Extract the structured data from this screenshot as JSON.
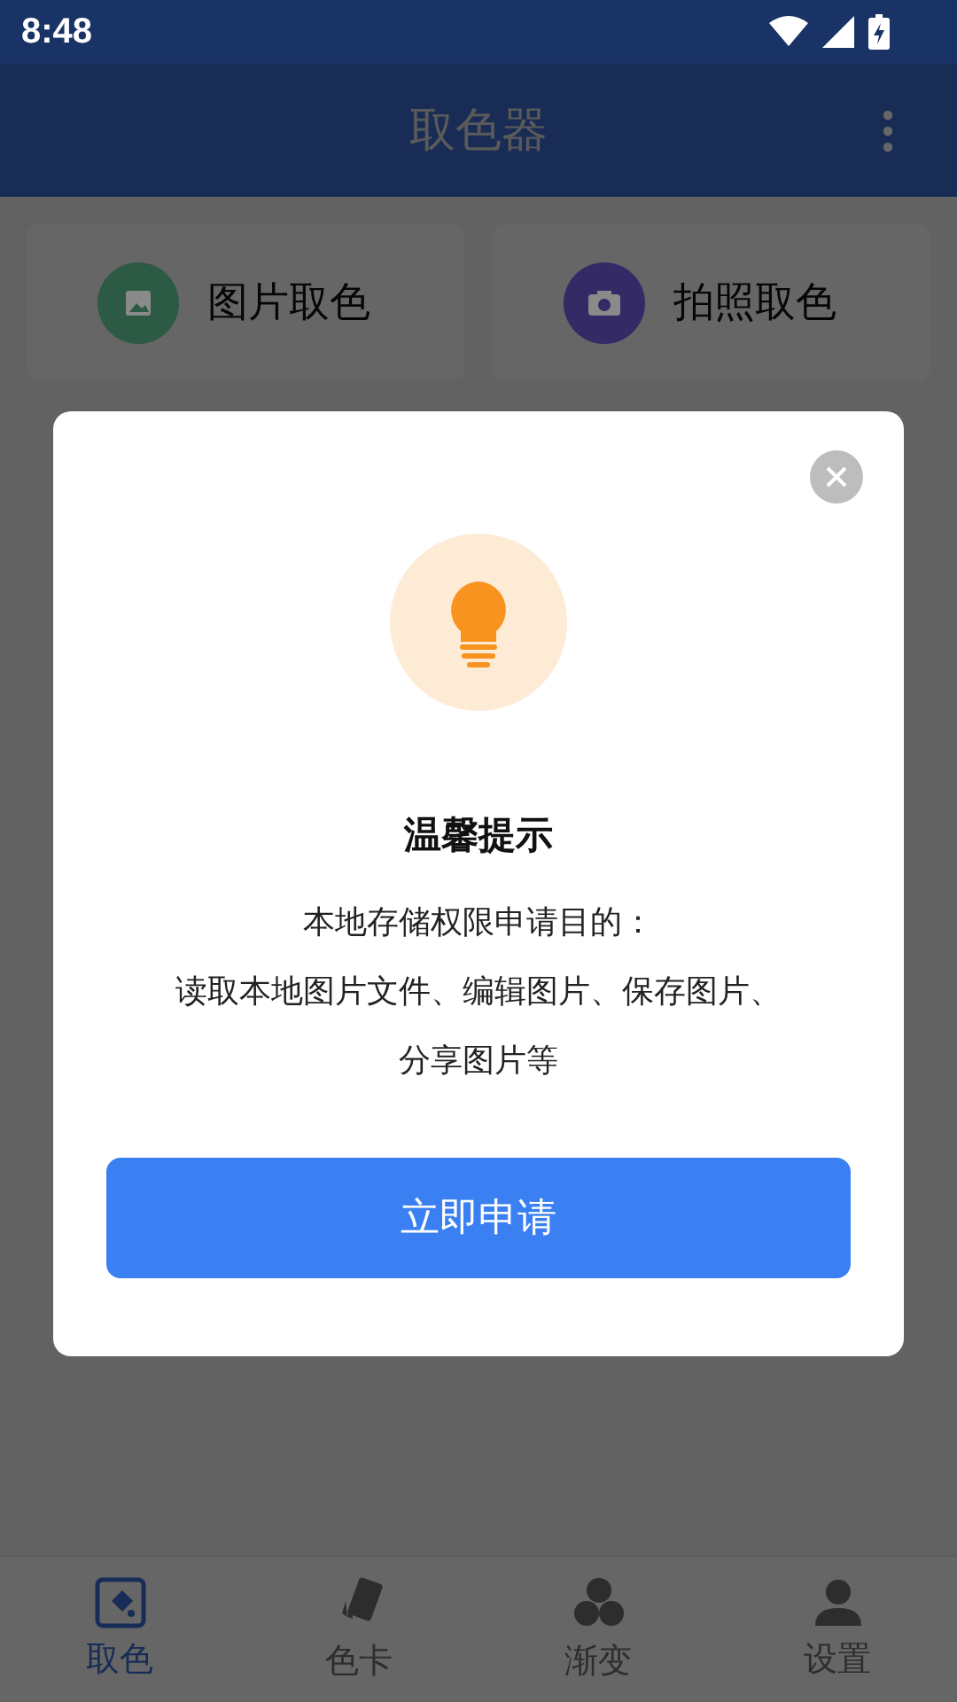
{
  "status_bar": {
    "time": "8:48"
  },
  "app_bar": {
    "title": "取色器"
  },
  "actions": [
    {
      "label": "图片取色",
      "kind": "image",
      "color": "#2c5a45"
    },
    {
      "label": "拍照取色",
      "kind": "camera",
      "color": "#332a66"
    }
  ],
  "dialog": {
    "title": "温馨提示",
    "message_lines": [
      "本地存储权限申请目的：",
      "读取本地图片文件、编辑图片、保存图片、",
      "分享图片等"
    ],
    "button": "立即申请"
  },
  "bottom_nav": [
    {
      "label": "取色",
      "kind": "pick",
      "selected": true
    },
    {
      "label": "色卡",
      "kind": "cards",
      "selected": false
    },
    {
      "label": "渐变",
      "kind": "gradient",
      "selected": false
    },
    {
      "label": "设置",
      "kind": "person",
      "selected": false
    }
  ]
}
